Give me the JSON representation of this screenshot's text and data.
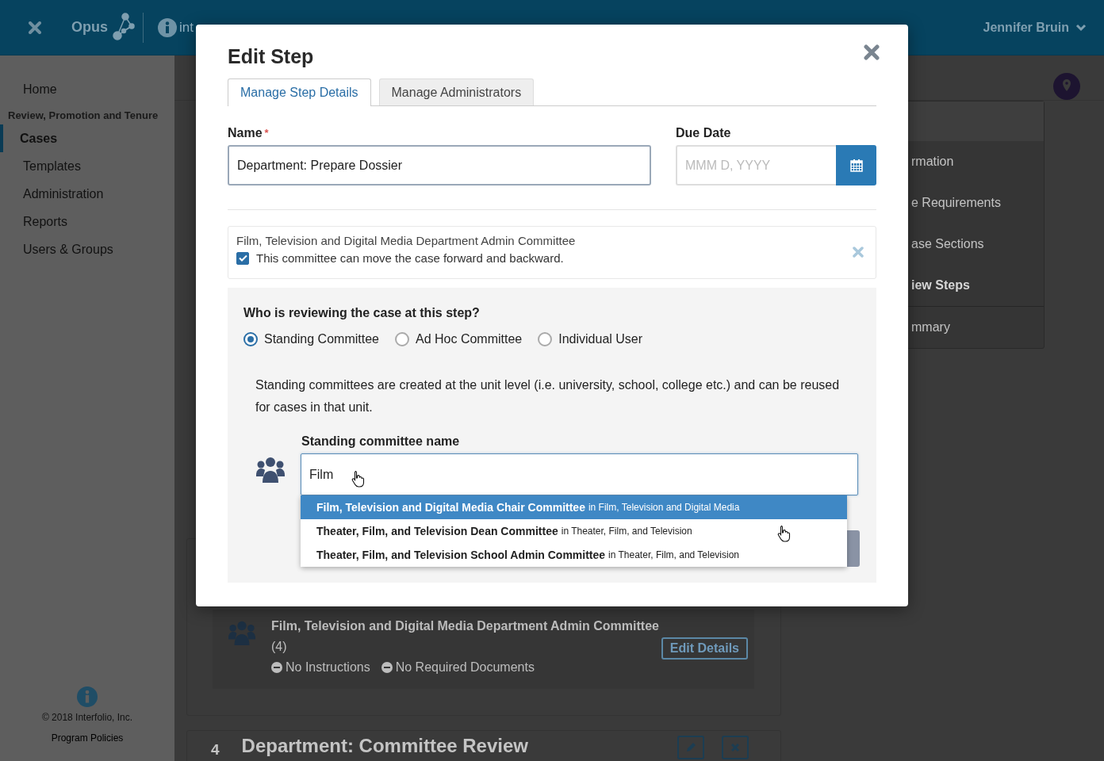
{
  "header": {
    "logo": "Opus",
    "partner": "int",
    "user": "Jennifer Bruin"
  },
  "sidebar": {
    "top": [
      {
        "label": "Home",
        "selected": false
      }
    ],
    "section": "Review, Promotion and Tenure",
    "items": [
      {
        "label": "Cases",
        "selected": true
      },
      {
        "label": "Templates",
        "selected": false
      },
      {
        "label": "Administration",
        "selected": false
      },
      {
        "label": "Reports",
        "selected": false
      },
      {
        "label": "Users & Groups",
        "selected": false
      }
    ],
    "copyright": "© 2018 Interfolio, Inc.",
    "link": "Program Policies"
  },
  "background": {
    "panel": {
      "items": [
        {
          "label": "rmation",
          "selected": false
        },
        {
          "label": "e Requirements",
          "selected": false
        },
        {
          "label": "ase Sections",
          "selected": false
        },
        {
          "label": "iew Steps",
          "selected": true
        }
      ],
      "footer": "mmary"
    },
    "committee_card": {
      "title": "Film, Television and Digital Media Department Admin Committee",
      "count": "(4)",
      "tags": [
        "No Instructions",
        "No Required Documents"
      ],
      "button": "Edit Details"
    },
    "next_step": {
      "number": "4",
      "title": "Department: Committee Review"
    }
  },
  "modal": {
    "title": "Edit Step",
    "tabs": [
      {
        "label": "Manage Step Details",
        "selected": true
      },
      {
        "label": "Manage Administrators",
        "selected": false
      }
    ],
    "name_field": {
      "label": "Name",
      "required_mark": "*",
      "value": "Department: Prepare Dossier"
    },
    "due_date": {
      "label": "Due Date",
      "placeholder": "MMM D, YYYY"
    },
    "assigned": {
      "committee": "Film, Television and Digital Media Department Admin Committee",
      "permission": "This committee can move the case forward and backward.",
      "checked": true
    },
    "reviewer": {
      "question": "Who is reviewing the case at this step?",
      "options": [
        {
          "label": "Standing Committee",
          "selected": true
        },
        {
          "label": "Ad Hoc Committee",
          "selected": false
        },
        {
          "label": "Individual User",
          "selected": false
        }
      ],
      "description": "Standing committees are created at the unit level (i.e. university, school, college etc.) and can be reused for cases in that unit.",
      "field": {
        "label": "Standing committee name",
        "value": "Film"
      },
      "suggestions": [
        {
          "name": "Film, Television and Digital Media Chair Committee",
          "context": "in Film, Television and Digital Media",
          "selected": true
        },
        {
          "name": "Theater, Film, and Television Dean Committee",
          "context": "in Theater, Film, and Television",
          "selected": false
        },
        {
          "name": "Theater, Film, and Television School Admin Committee",
          "context": "in Theater, Film, and Television",
          "selected": false
        }
      ]
    }
  }
}
